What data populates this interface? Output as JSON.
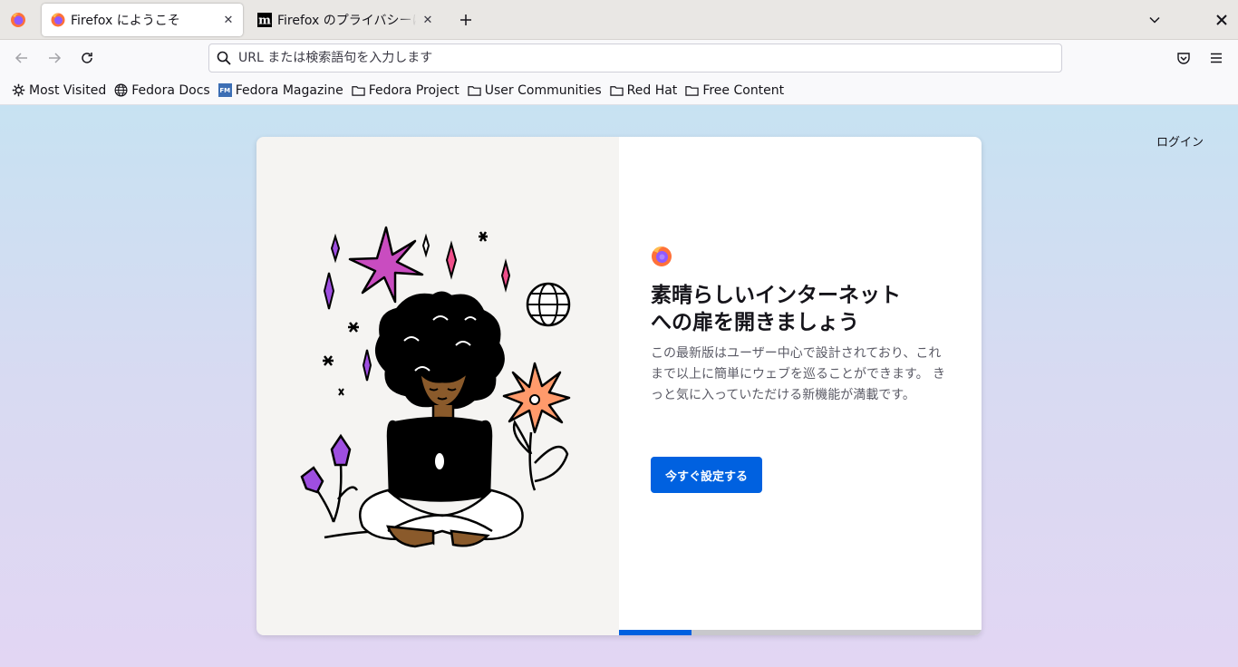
{
  "tabs": [
    {
      "title": "Firefox にようこそ",
      "icon": "firefox-icon",
      "active": true,
      "close_label": "✕"
    },
    {
      "title": "Firefox のプライバシーに関する",
      "icon": "mozilla-m-icon",
      "active": false,
      "close_label": "✕"
    }
  ],
  "tabstrip": {
    "new_tab": "+",
    "close_window": "✕"
  },
  "urlbar": {
    "placeholder": "URL または検索語句を入力します",
    "value": ""
  },
  "bookmarks": [
    {
      "label": "Most Visited",
      "icon": "gear-icon"
    },
    {
      "label": "Fedora Docs",
      "icon": "globe-icon"
    },
    {
      "label": "Fedora Magazine",
      "icon": "fm-logo-icon",
      "badge": "FM"
    },
    {
      "label": "Fedora Project",
      "icon": "folder-icon"
    },
    {
      "label": "User Communities",
      "icon": "folder-icon"
    },
    {
      "label": "Red Hat",
      "icon": "folder-icon"
    },
    {
      "label": "Free Content",
      "icon": "folder-icon"
    }
  ],
  "page": {
    "login": "ログイン",
    "headline_line1": "素晴らしいインターネット",
    "headline_line2": "への扉を開きましょう",
    "body": "この最新版はユーザー中心で設計されており、これまで以上に簡単にウェブを巡ることができます。 きっと気に入っていただける新機能が満載です。",
    "cta": "今すぐ設定する",
    "progress": 0.2
  },
  "colors": {
    "accent": "#0061e0",
    "tab_bg": "#e9e7e4",
    "content_top": "#c7e2f2",
    "content_bottom": "#e2d6f3"
  }
}
